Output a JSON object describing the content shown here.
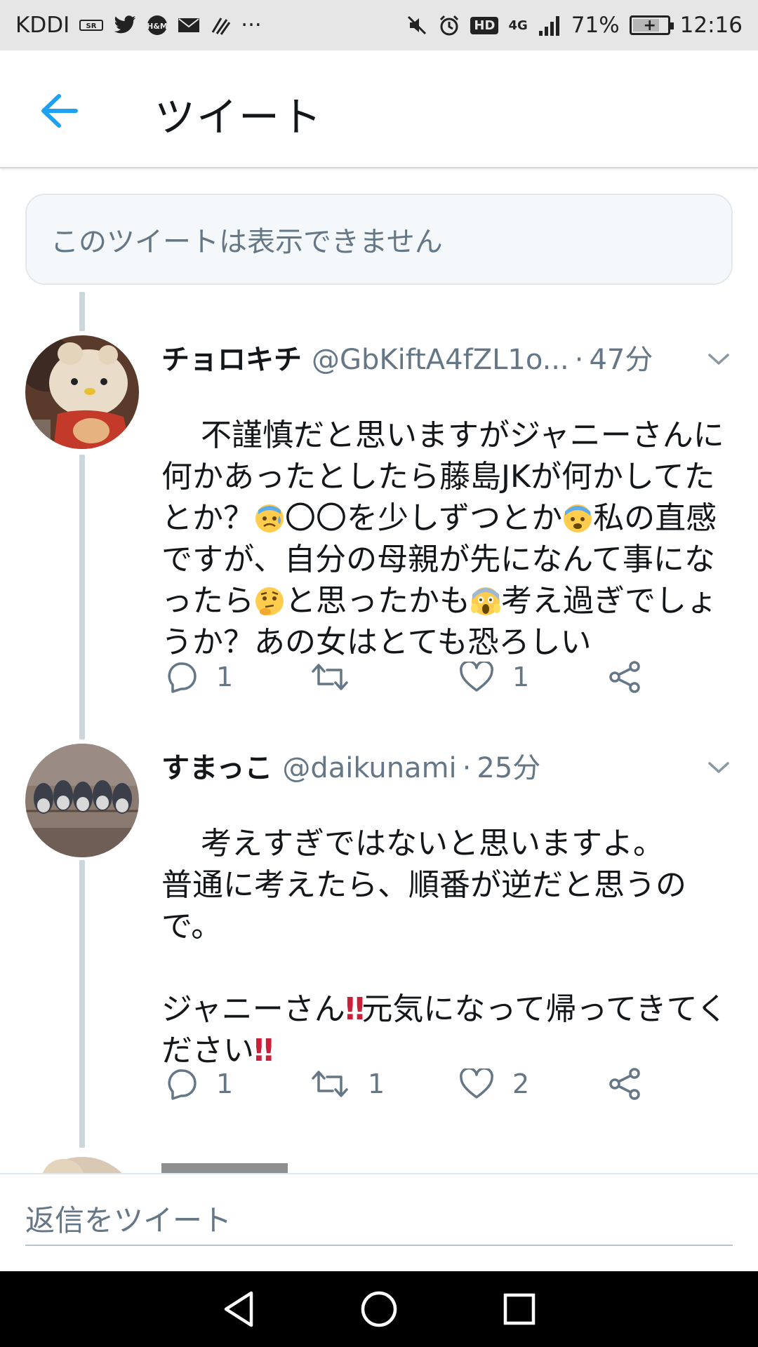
{
  "status_bar": {
    "carrier": "KDDI",
    "app_icons": [
      "sr-icon",
      "twitter-bird-icon",
      "hm-icon",
      "mail-icon",
      "signal-misc-icon"
    ],
    "overflow": "···",
    "network": "4G",
    "battery": "71%",
    "time": "12:16"
  },
  "header": {
    "title": "ツイート"
  },
  "unavailable": {
    "text": "このツイートは表示できません"
  },
  "tweets": [
    {
      "name": "チョロキチ",
      "handle": "@GbKiftA4fZL1o...",
      "time": "47分",
      "body_parts": [
        "不謹慎だと思いますがジャニーさんに何かあったとしたら藤島JKが何かしてたとか？",
        "〇〇を少しずつとか",
        "私の直感ですが、自分の母親が先になんて事になったら",
        "と思ったかも",
        "考え過ぎでしょうか？あの女はとても恐ろしい"
      ],
      "emojis": [
        "sweat-face-emoji",
        "fearful-face-emoji",
        "thinking-face-emoji",
        "scream-face-emoji"
      ],
      "replies": "1",
      "retweets": "",
      "likes": "1"
    },
    {
      "name": "すまっこ",
      "handle": "@daikunami",
      "time": "25分",
      "body_parts": [
        "考えすぎではないと思いますよ。\n普通に考えたら、順番が逆だと思うので。\n\nジャニーさん",
        "元気になって帰ってきてください"
      ],
      "emojis": [
        "double-exclamation-emoji",
        "double-exclamation-emoji"
      ],
      "emoji_text": "‼",
      "replies": "1",
      "retweets": "1",
      "likes": "2"
    }
  ],
  "reply": {
    "placeholder": "返信をツイート"
  }
}
